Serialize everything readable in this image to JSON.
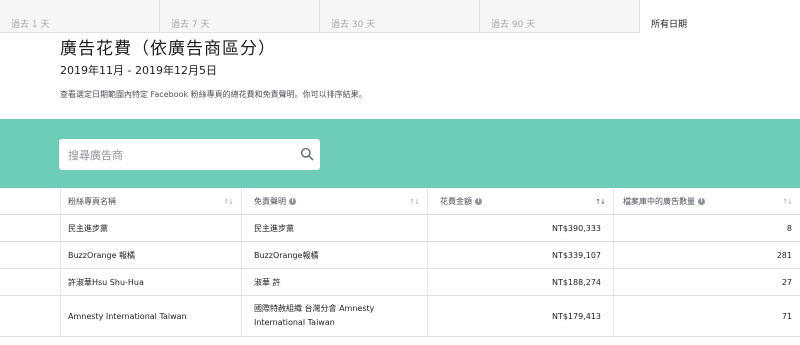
{
  "tabs": [
    {
      "label": "過去 1 天",
      "active": false
    },
    {
      "label": "過去 7 天",
      "active": false
    },
    {
      "label": "過去 30 天",
      "active": false
    },
    {
      "label": "過去 90 天",
      "active": false
    },
    {
      "label": "所有日期",
      "active": true
    }
  ],
  "header": {
    "title": "廣告花費（依廣告商區分）",
    "date_range": "2019年11月 - 2019年12月5日",
    "description": "查看選定日期範圍內特定 Facebook 粉絲專頁的總花費和免責聲明。你可以排序結果。"
  },
  "search": {
    "placeholder": "搜尋廣告商",
    "value": ""
  },
  "colors": {
    "accent_band": "#6ecdb8"
  },
  "table": {
    "columns": [
      {
        "label": "粉絲專頁名稱",
        "info": false
      },
      {
        "label": "免責聲明",
        "info": true
      },
      {
        "label": "花費金額",
        "info": true
      },
      {
        "label": "檔案庫中的廣告數量",
        "info": true
      }
    ],
    "rows": [
      {
        "page": "民主進步黨",
        "disclaimer": "民主進步黨",
        "disclaimer_line2": "",
        "spend": "NT$390,333",
        "ads": "8"
      },
      {
        "page": "BuzzOrange 報橘",
        "disclaimer": "BuzzOrange報橘",
        "disclaimer_line2": "",
        "spend": "NT$339,107",
        "ads": "281"
      },
      {
        "page": "許淑華Hsu Shu-Hua",
        "disclaimer": "淑華 許",
        "disclaimer_line2": "",
        "spend": "NT$188,274",
        "ads": "27"
      },
      {
        "page": "Amnesty International Taiwan",
        "disclaimer": "國際特赦組織 台灣分會 Amnesty",
        "disclaimer_line2": "International Taiwan",
        "spend": "NT$179,413",
        "ads": "71"
      }
    ]
  }
}
